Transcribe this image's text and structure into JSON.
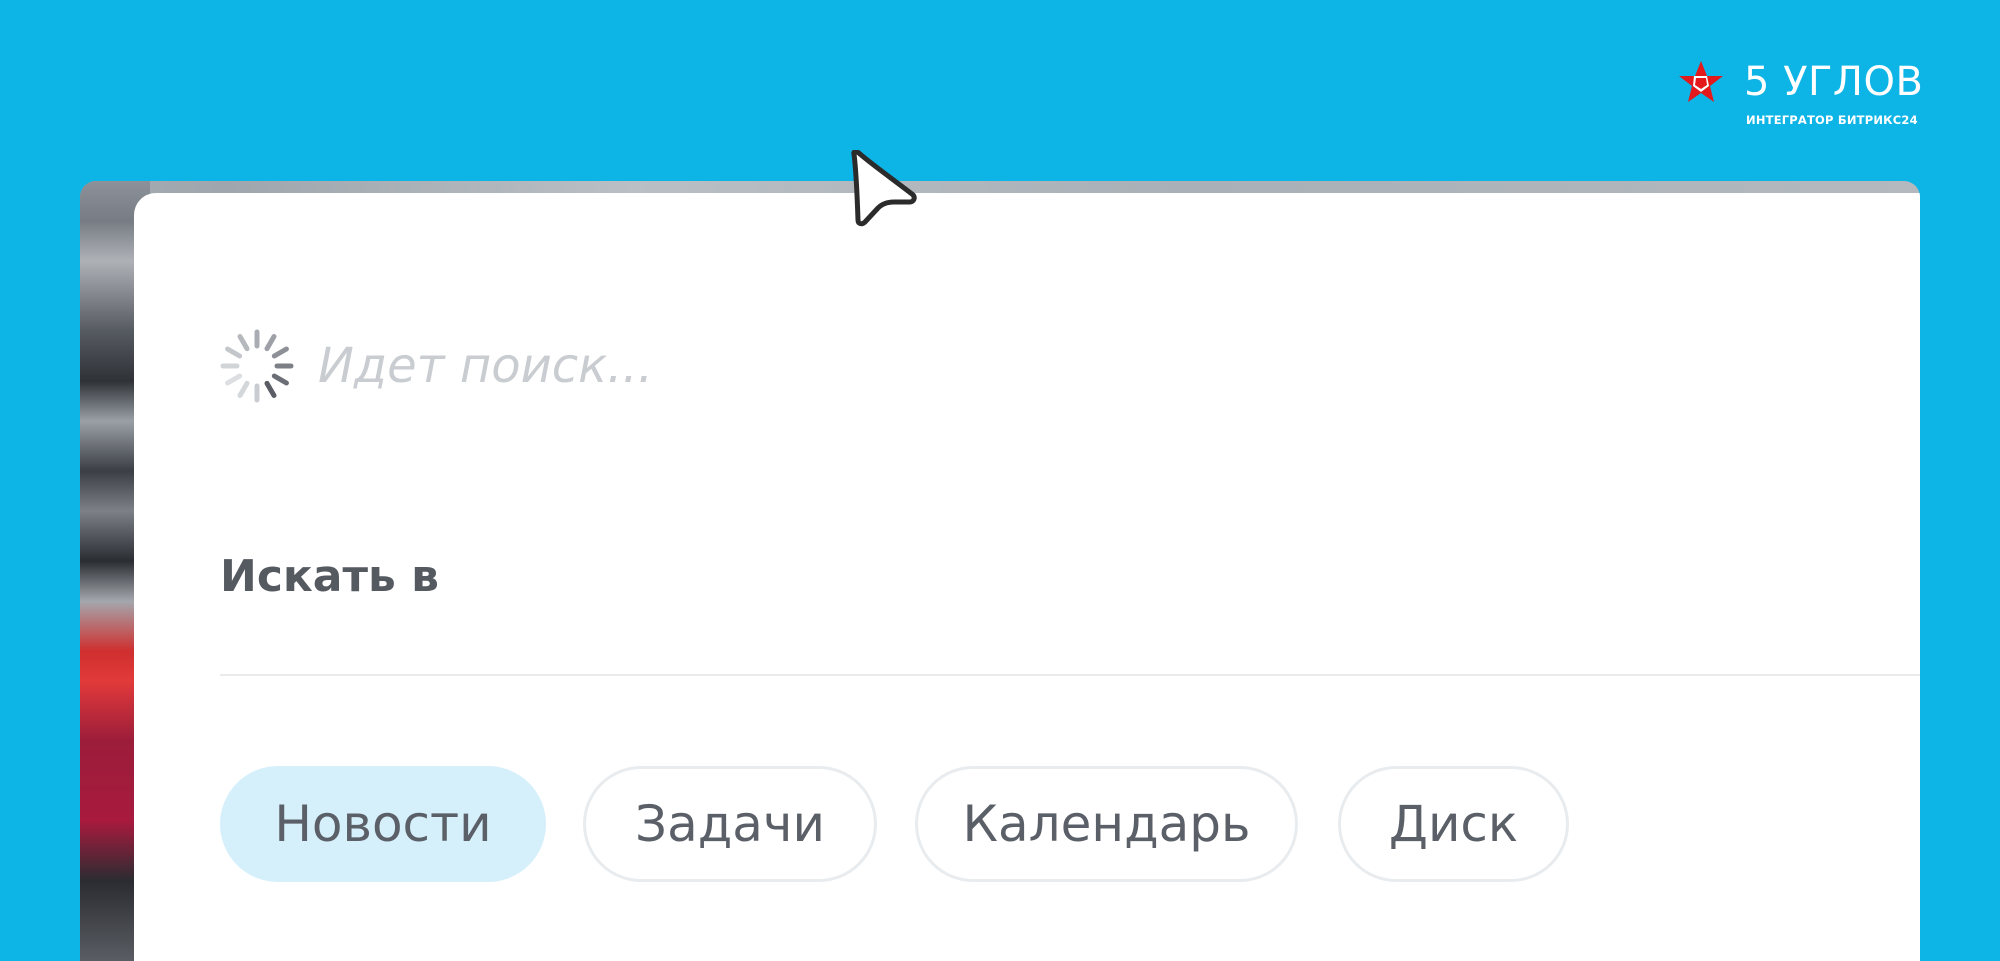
{
  "brand": {
    "title": "5 УГЛОВ",
    "subtitle": "ИНТЕГРАТОР БИТРИКС24",
    "mark_icon": "pentagon-star-logo-icon",
    "mark_color": "#e3191b"
  },
  "search": {
    "placeholder": "Идет поиск...",
    "status_icon": "loading-spinner-icon"
  },
  "scope": {
    "title": "Искать в",
    "chips": [
      {
        "label": "Новости",
        "active": true
      },
      {
        "label": "Задачи",
        "active": false
      },
      {
        "label": "Календарь",
        "active": false
      },
      {
        "label": "Диск",
        "active": false
      }
    ]
  },
  "colors": {
    "background": "#0db4e6",
    "chip_active": "#d5f0fb",
    "text": "#555a61"
  }
}
